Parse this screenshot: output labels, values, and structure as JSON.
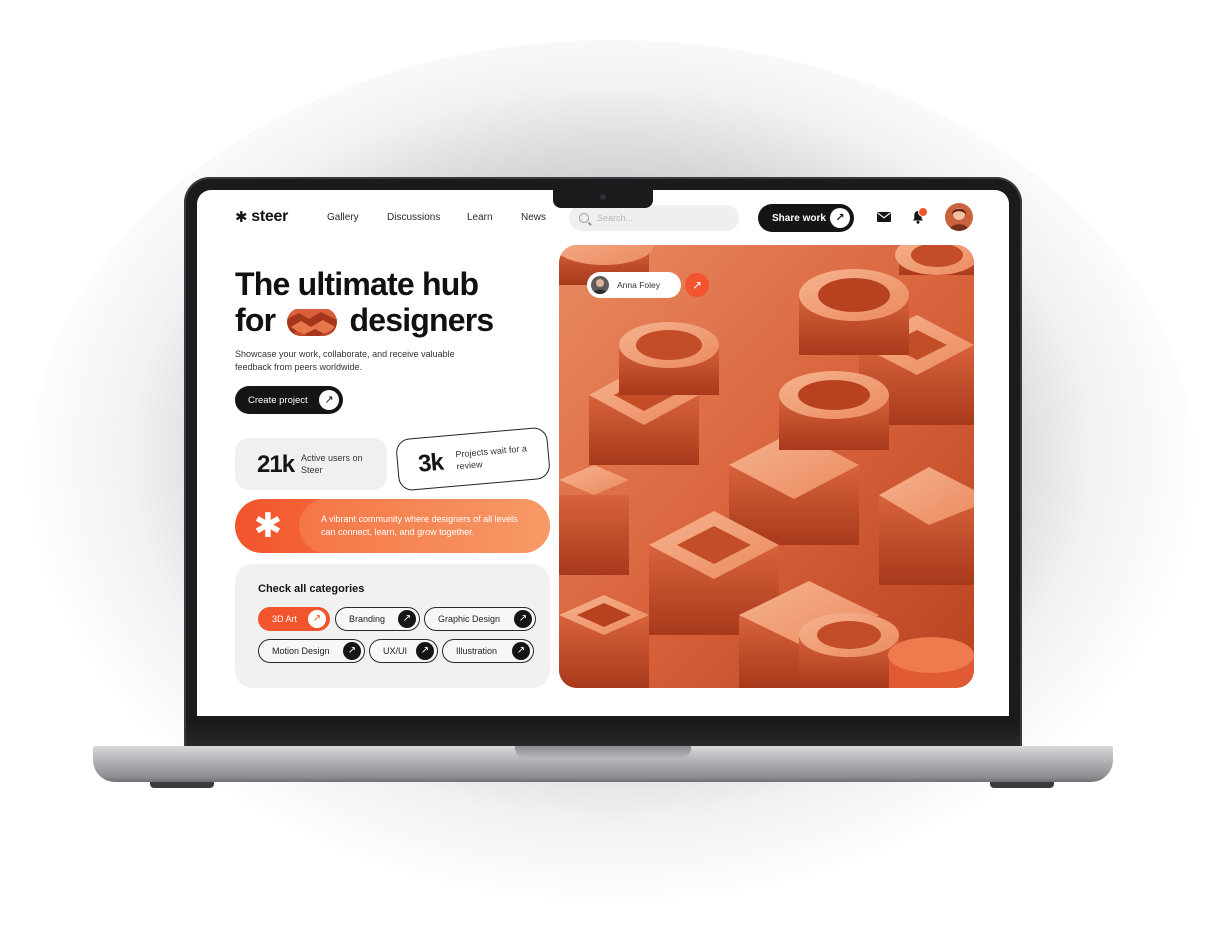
{
  "brand": {
    "name": "steer",
    "accent": "#f2542d",
    "dark": "#151515"
  },
  "nav": {
    "items": [
      "Gallery",
      "Discussions",
      "Learn",
      "News"
    ]
  },
  "search": {
    "placeholder": "Search..."
  },
  "header": {
    "share_label": "Share work",
    "icons": [
      "search-icon",
      "mail-icon",
      "bell-icon",
      "arrow-up-right-icon"
    ]
  },
  "hero": {
    "title_line1": "The ultimate hub",
    "title_line2_a": "for",
    "title_line2_b": "designers",
    "subtitle": "Showcase your work, collaborate, and receive valuable feedback from peers worldwide.",
    "cta_label": "Create project"
  },
  "stats": [
    {
      "value": "21k",
      "label": "Active users on Steer"
    },
    {
      "value": "3k",
      "label": "Projects wait for a review"
    }
  ],
  "banner": {
    "text": "A vibrant community where designers of all levels can connect, learn, and grow together."
  },
  "categories": {
    "title": "Check all categories",
    "items": [
      {
        "label": "3D Art",
        "active": true
      },
      {
        "label": "Branding",
        "active": false
      },
      {
        "label": "Graphic Design",
        "active": false
      },
      {
        "label": "Motion Design",
        "active": false
      },
      {
        "label": "UX/UI",
        "active": false
      },
      {
        "label": "Illustration",
        "active": false
      }
    ]
  },
  "featured": {
    "author": "Anna Foley"
  }
}
